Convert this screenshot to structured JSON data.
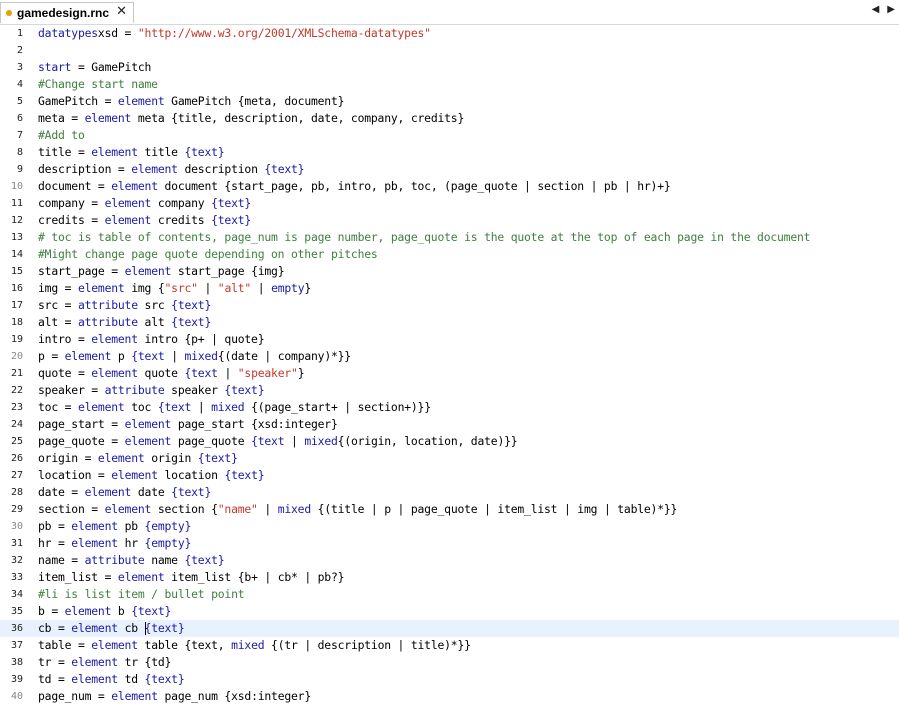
{
  "tab": {
    "title": "gamedesign.rnc",
    "close": "✕",
    "prev": "◀",
    "next": "▶"
  },
  "lines": [
    {
      "n": "1",
      "t": [
        [
          "kw",
          "datatypes"
        ],
        [
          "",
          "xsd = "
        ],
        [
          "str",
          "\"http://www.w3.org/2001/XMLSchema-datatypes\""
        ]
      ]
    },
    {
      "n": "2",
      "t": []
    },
    {
      "n": "3",
      "t": [
        [
          "kw",
          "start"
        ],
        [
          "",
          " = GamePitch"
        ]
      ]
    },
    {
      "n": "4",
      "t": [
        [
          "com",
          "#Change start name"
        ]
      ]
    },
    {
      "n": "5",
      "t": [
        [
          "",
          "GamePitch = "
        ],
        [
          "kw",
          "element"
        ],
        [
          "",
          " GamePitch {meta, document}"
        ]
      ]
    },
    {
      "n": "6",
      "t": [
        [
          "",
          "meta = "
        ],
        [
          "kw",
          "element"
        ],
        [
          "",
          " meta {title, description, date, company, credits}"
        ]
      ]
    },
    {
      "n": "7",
      "t": [
        [
          "com",
          "#Add to"
        ]
      ]
    },
    {
      "n": "8",
      "t": [
        [
          "",
          "title = "
        ],
        [
          "kw",
          "element"
        ],
        [
          "",
          " title "
        ],
        [
          "kw",
          "{text}"
        ]
      ]
    },
    {
      "n": "9",
      "t": [
        [
          "",
          "description = "
        ],
        [
          "kw",
          "element"
        ],
        [
          "",
          " description "
        ],
        [
          "kw",
          "{text}"
        ]
      ]
    },
    {
      "n": "10",
      "t": [
        [
          "",
          "document = "
        ],
        [
          "kw",
          "element"
        ],
        [
          "",
          " document {start_page, pb, intro, pb, toc, (page_quote | section | pb | hr)+}"
        ]
      ]
    },
    {
      "n": "11",
      "t": [
        [
          "",
          "company = "
        ],
        [
          "kw",
          "element"
        ],
        [
          "",
          " company "
        ],
        [
          "kw",
          "{text}"
        ]
      ]
    },
    {
      "n": "12",
      "t": [
        [
          "",
          "credits = "
        ],
        [
          "kw",
          "element"
        ],
        [
          "",
          " credits "
        ],
        [
          "kw",
          "{text}"
        ]
      ]
    },
    {
      "n": "13",
      "t": [
        [
          "com",
          "# toc is table of contents, page_num is page number, page_quote is the quote at the top of each page in the document"
        ]
      ]
    },
    {
      "n": "14",
      "t": [
        [
          "com",
          "#Might change page quote depending on other pitches"
        ]
      ]
    },
    {
      "n": "15",
      "t": [
        [
          "",
          "start_page = "
        ],
        [
          "kw",
          "element"
        ],
        [
          "",
          " start_page {img}"
        ]
      ]
    },
    {
      "n": "16",
      "t": [
        [
          "",
          "img = "
        ],
        [
          "kw",
          "element"
        ],
        [
          "",
          " img {"
        ],
        [
          "str",
          "\"src\""
        ],
        [
          "",
          " | "
        ],
        [
          "str",
          "\"alt\""
        ],
        [
          "",
          " | "
        ],
        [
          "kw",
          "empty"
        ],
        [
          "",
          "}"
        ]
      ]
    },
    {
      "n": "17",
      "t": [
        [
          "",
          "src = "
        ],
        [
          "kw",
          "attribute"
        ],
        [
          "",
          " src "
        ],
        [
          "kw",
          "{text}"
        ]
      ]
    },
    {
      "n": "18",
      "t": [
        [
          "",
          "alt = "
        ],
        [
          "kw",
          "attribute"
        ],
        [
          "",
          " alt "
        ],
        [
          "kw",
          "{text}"
        ]
      ]
    },
    {
      "n": "19",
      "t": [
        [
          "",
          "intro = "
        ],
        [
          "kw",
          "element"
        ],
        [
          "",
          " intro {p+ | quote}"
        ]
      ]
    },
    {
      "n": "20",
      "t": [
        [
          "",
          "p = "
        ],
        [
          "kw",
          "element"
        ],
        [
          "",
          " p "
        ],
        [
          "kw",
          "{text"
        ],
        [
          "",
          " | "
        ],
        [
          "kw",
          "mixed"
        ],
        [
          "",
          "{(date | company)*}}"
        ]
      ]
    },
    {
      "n": "21",
      "t": [
        [
          "",
          "quote = "
        ],
        [
          "kw",
          "element"
        ],
        [
          "",
          " quote "
        ],
        [
          "kw",
          "{text"
        ],
        [
          "",
          " | "
        ],
        [
          "str",
          "\"speaker\""
        ],
        [
          "",
          "}"
        ]
      ]
    },
    {
      "n": "22",
      "t": [
        [
          "",
          "speaker = "
        ],
        [
          "kw",
          "attribute"
        ],
        [
          "",
          " speaker "
        ],
        [
          "kw",
          "{text}"
        ]
      ]
    },
    {
      "n": "23",
      "t": [
        [
          "",
          "toc = "
        ],
        [
          "kw",
          "element"
        ],
        [
          "",
          " toc "
        ],
        [
          "kw",
          "{text"
        ],
        [
          "",
          " | "
        ],
        [
          "kw",
          "mixed"
        ],
        [
          "",
          " {(page_start+ | section+)}}"
        ]
      ]
    },
    {
      "n": "24",
      "t": [
        [
          "",
          "page_start = "
        ],
        [
          "kw",
          "element"
        ],
        [
          "",
          " page_start {xsd:integer}"
        ]
      ]
    },
    {
      "n": "25",
      "t": [
        [
          "",
          "page_quote = "
        ],
        [
          "kw",
          "element"
        ],
        [
          "",
          " page_quote "
        ],
        [
          "kw",
          "{text"
        ],
        [
          "",
          " | "
        ],
        [
          "kw",
          "mixed"
        ],
        [
          "",
          "{(origin, location, date)}}"
        ]
      ]
    },
    {
      "n": "26",
      "t": [
        [
          "",
          "origin = "
        ],
        [
          "kw",
          "element"
        ],
        [
          "",
          " origin "
        ],
        [
          "kw",
          "{text}"
        ]
      ]
    },
    {
      "n": "27",
      "t": [
        [
          "",
          "location = "
        ],
        [
          "kw",
          "element"
        ],
        [
          "",
          " location "
        ],
        [
          "kw",
          "{text}"
        ]
      ]
    },
    {
      "n": "28",
      "t": [
        [
          "",
          "date = "
        ],
        [
          "kw",
          "element"
        ],
        [
          "",
          " date "
        ],
        [
          "kw",
          "{text}"
        ]
      ]
    },
    {
      "n": "29",
      "t": [
        [
          "",
          "section = "
        ],
        [
          "kw",
          "element"
        ],
        [
          "",
          " section {"
        ],
        [
          "str",
          "\"name\""
        ],
        [
          "",
          " | "
        ],
        [
          "kw",
          "mixed"
        ],
        [
          "",
          " {(title | p | page_quote | item_list | img | table)*}}"
        ]
      ]
    },
    {
      "n": "30",
      "t": [
        [
          "",
          "pb = "
        ],
        [
          "kw",
          "element"
        ],
        [
          "",
          " pb "
        ],
        [
          "kw",
          "{empty}"
        ]
      ]
    },
    {
      "n": "31",
      "t": [
        [
          "",
          "hr = "
        ],
        [
          "kw",
          "element"
        ],
        [
          "",
          " hr "
        ],
        [
          "kw",
          "{empty}"
        ]
      ]
    },
    {
      "n": "32",
      "t": [
        [
          "",
          "name = "
        ],
        [
          "kw",
          "attribute"
        ],
        [
          "",
          " name "
        ],
        [
          "kw",
          "{text}"
        ]
      ]
    },
    {
      "n": "33",
      "t": [
        [
          "",
          "item_list = "
        ],
        [
          "kw",
          "element"
        ],
        [
          "",
          " item_list {b+ | cb* | pb?}"
        ]
      ]
    },
    {
      "n": "34",
      "t": [
        [
          "com",
          "#li is list item / bullet point"
        ]
      ]
    },
    {
      "n": "35",
      "t": [
        [
          "",
          "b = "
        ],
        [
          "kw",
          "element"
        ],
        [
          "",
          " b "
        ],
        [
          "kw",
          "{text}"
        ]
      ]
    },
    {
      "n": "36",
      "t": [
        [
          "",
          "cb = "
        ],
        [
          "kw",
          "element"
        ],
        [
          "",
          " cb "
        ],
        [
          "cursor",
          ""
        ],
        [
          "kw",
          "{text}"
        ]
      ]
    },
    {
      "n": "37",
      "t": [
        [
          "",
          "table = "
        ],
        [
          "kw",
          "element"
        ],
        [
          "",
          " table {text, "
        ],
        [
          "kw",
          "mixed"
        ],
        [
          "",
          " {(tr | description | title)*}}"
        ]
      ]
    },
    {
      "n": "38",
      "t": [
        [
          "",
          "tr = "
        ],
        [
          "kw",
          "element"
        ],
        [
          "",
          " tr {td}"
        ]
      ]
    },
    {
      "n": "39",
      "t": [
        [
          "",
          "td = "
        ],
        [
          "kw",
          "element"
        ],
        [
          "",
          " td "
        ],
        [
          "kw",
          "{text}"
        ]
      ]
    },
    {
      "n": "40",
      "t": [
        [
          "",
          "page_num = "
        ],
        [
          "kw",
          "element"
        ],
        [
          "",
          " page_num {xsd:integer}"
        ]
      ]
    }
  ],
  "current_line": "36",
  "colors": {
    "keyword": "#1a1aa6",
    "comment": "#3f7f3f",
    "string": "#c0392b",
    "current_line_bg": "#e8f2fe",
    "modified_dot": "#e8a000"
  }
}
